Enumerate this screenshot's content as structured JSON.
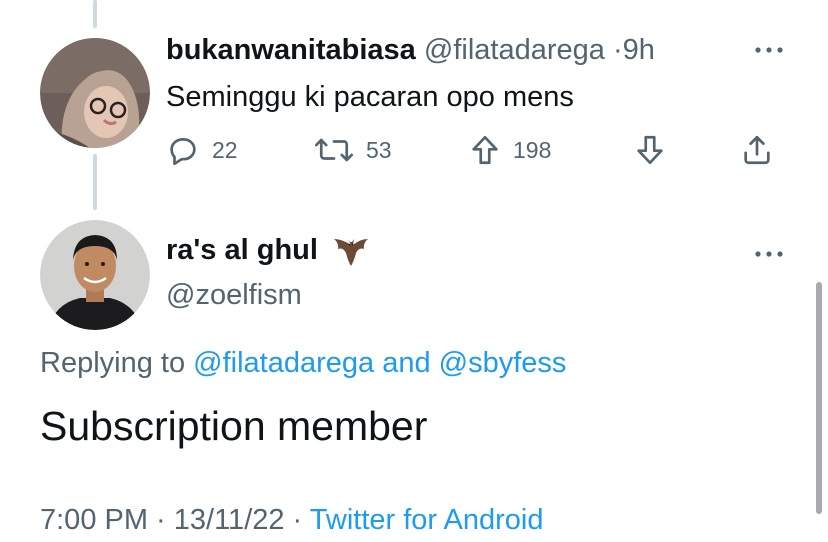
{
  "tweet1": {
    "display_name": "bukanwanitabiasa",
    "handle": "@filatadarega",
    "separator": "·",
    "time": "9h",
    "text": "Seminggu ki pacaran opo mens",
    "actions": {
      "reply_count": "22",
      "retweet_count": "53",
      "upvote_count": "198"
    }
  },
  "tweet2": {
    "display_name": "ra's al ghul",
    "name_emoji": "bat",
    "handle": "@zoelfism",
    "replying_prefix": "Replying to",
    "replying_user1": "@filatadarega",
    "replying_and": "and",
    "replying_user2": "@sbyfess",
    "text": "Subscription member",
    "timestamp_partial": "7:00 PM · 13/11/22 ·",
    "app_partial": "Twitter for Android"
  },
  "colors": {
    "primary_text": "#0f1419",
    "secondary_text": "#536471",
    "link": "#1d9bf0",
    "thread_line": "#cfd9de"
  }
}
